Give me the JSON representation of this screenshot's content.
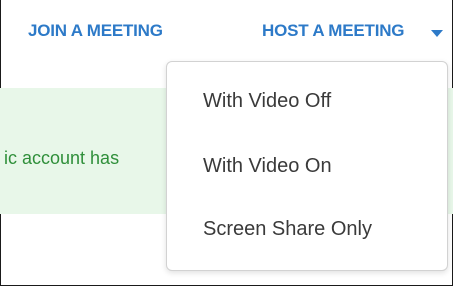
{
  "nav": {
    "join_label": "JOIN A MEETING",
    "host_label": "HOST A MEETING"
  },
  "banner": {
    "text": "ic account has"
  },
  "host_menu": {
    "items": [
      {
        "label": "With Video Off"
      },
      {
        "label": "With Video On"
      },
      {
        "label": "Screen Share Only"
      }
    ]
  },
  "colors": {
    "link": "#2d7ac8",
    "banner_bg": "#e8f7e9",
    "banner_text": "#2f8f3a",
    "menu_text": "#3a3a3a"
  },
  "icons": {
    "host_caret": "chevron-down-icon"
  }
}
